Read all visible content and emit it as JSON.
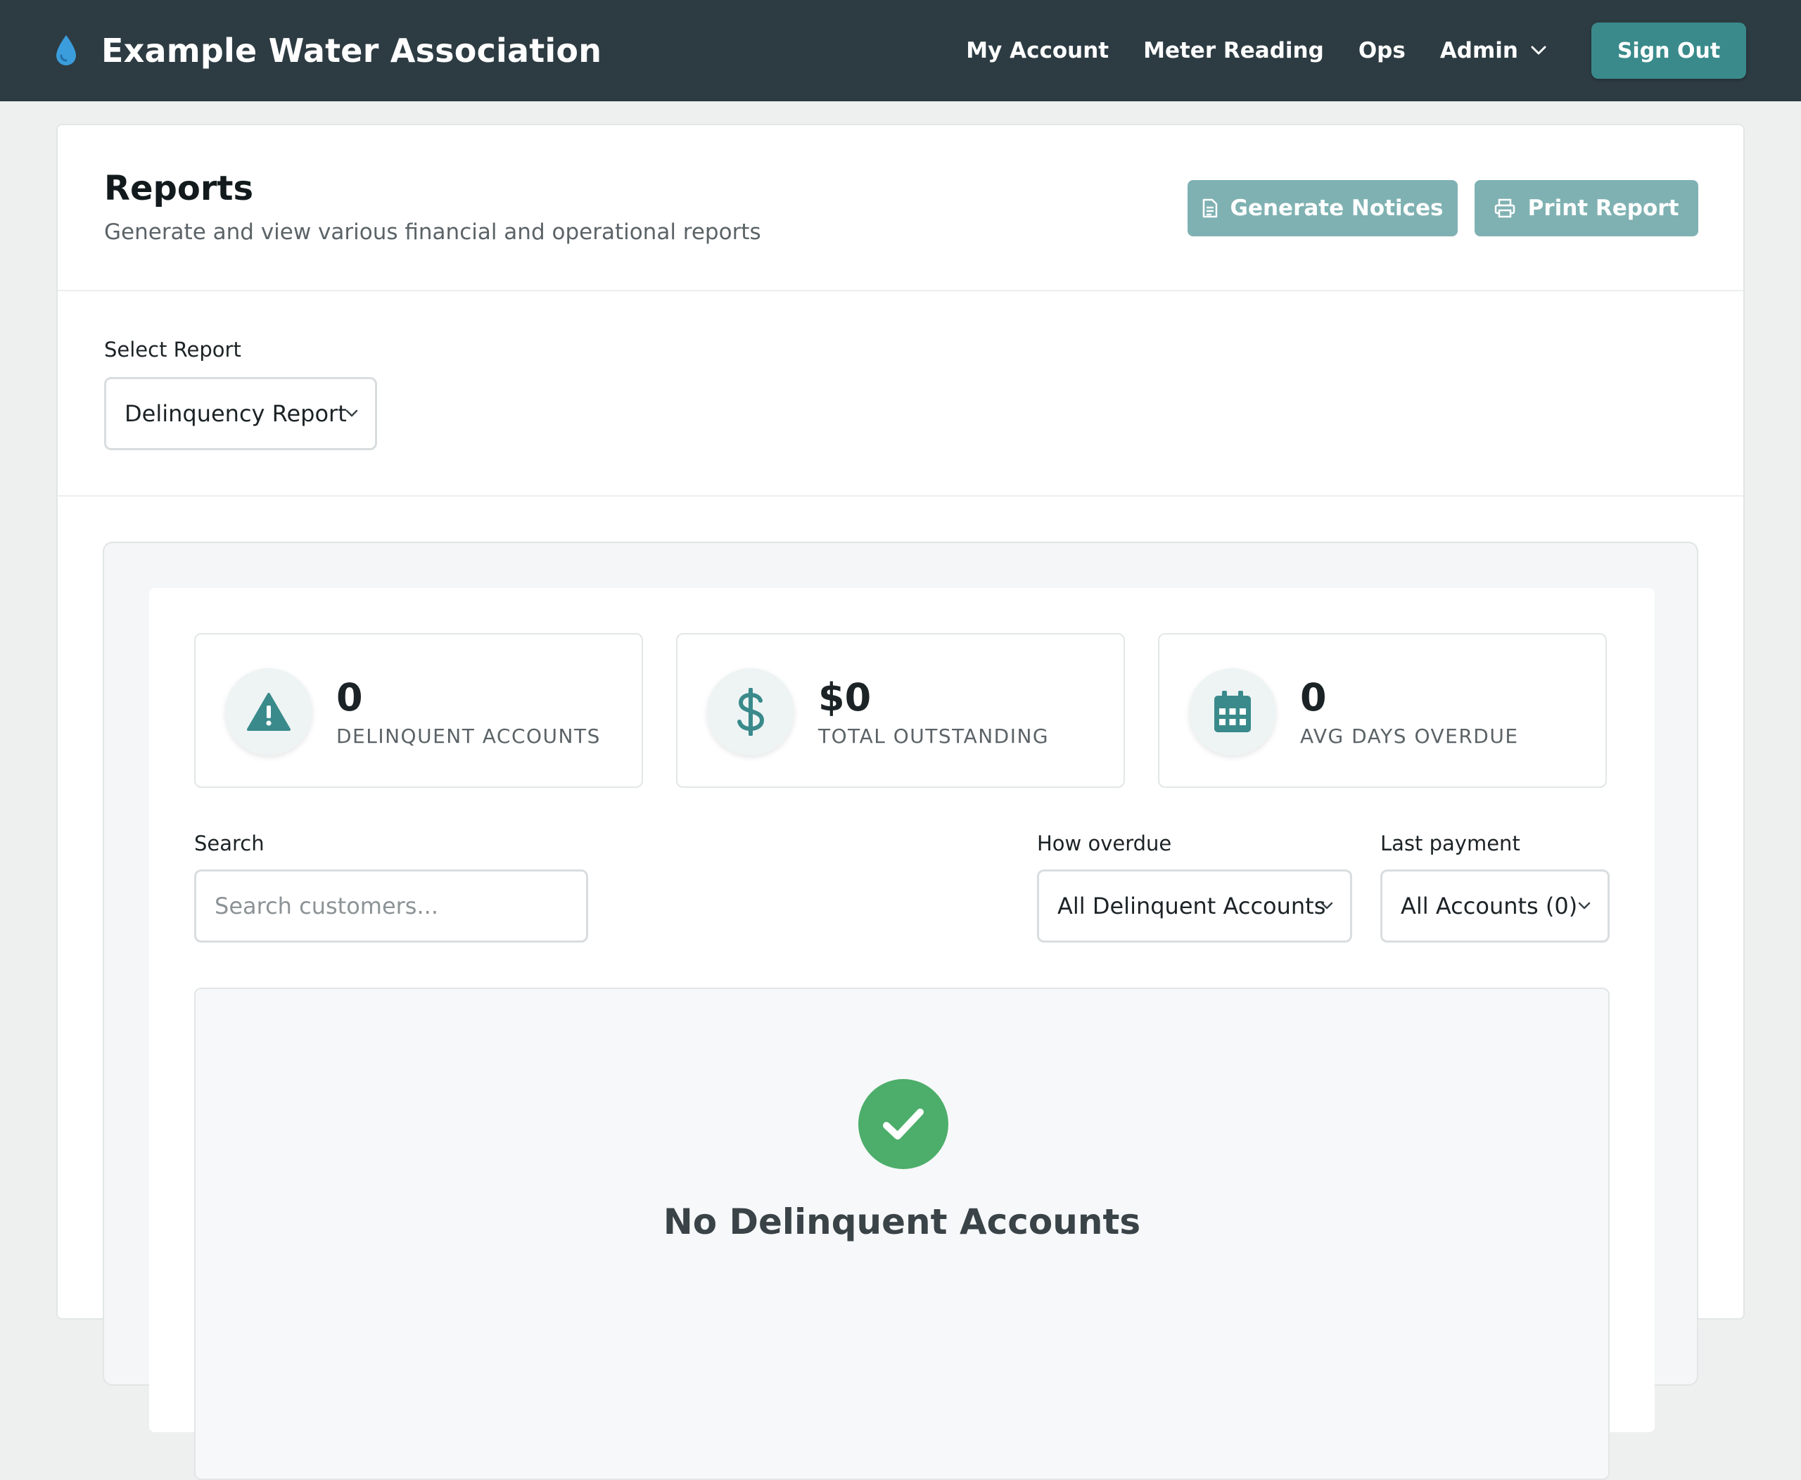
{
  "header": {
    "app_title": "Example Water Association",
    "nav": [
      {
        "label": "My Account"
      },
      {
        "label": "Meter Reading"
      },
      {
        "label": "Ops"
      },
      {
        "label": "Admin"
      }
    ],
    "sign_out": "Sign Out",
    "brand_color": "#2d3b42",
    "accent_color": "#3a8a8b"
  },
  "page": {
    "title": "Reports",
    "subtitle": "Generate and view various financial and operational reports",
    "actions": {
      "generate_notices": "Generate Notices",
      "print_report": "Print Report"
    }
  },
  "report_selector": {
    "label": "Select Report",
    "selected": "Delinquency Report"
  },
  "stats": [
    {
      "value": "0",
      "label": "DELINQUENT ACCOUNTS",
      "icon": "warning-icon"
    },
    {
      "value": "$0",
      "label": "TOTAL OUTSTANDING",
      "icon": "dollar-icon"
    },
    {
      "value": "0",
      "label": "AVG DAYS OVERDUE",
      "icon": "calendar-icon"
    }
  ],
  "filters": {
    "search_label": "Search",
    "search_placeholder": "Search customers...",
    "search_value": "",
    "overdue_label": "How overdue",
    "overdue_selected": "All Delinquent Accounts",
    "last_payment_label": "Last payment",
    "last_payment_selected": "All Accounts (0)"
  },
  "empty_state": {
    "title": "No Delinquent Accounts",
    "icon": "check-circle-icon",
    "color": "#4cae6a"
  }
}
